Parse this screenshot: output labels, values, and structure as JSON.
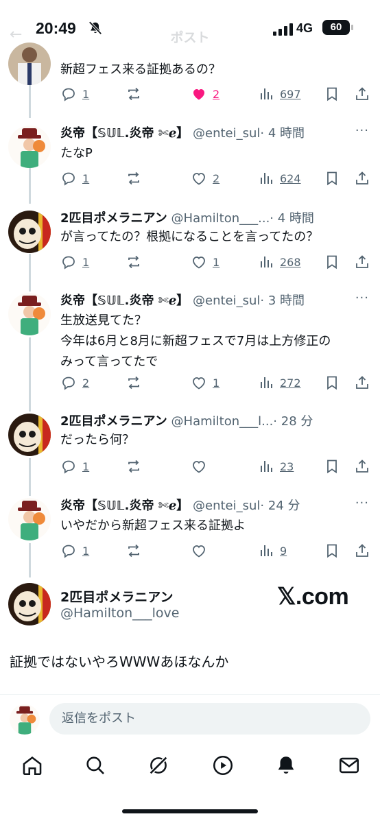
{
  "status_bar": {
    "time": "20:49",
    "network": "4G",
    "battery": "60"
  },
  "header": {
    "title": "ポスト",
    "back": "←"
  },
  "tweets": [
    {
      "name": "",
      "handle": "",
      "time": "",
      "text": "新超フェス来る証拠あるの？",
      "replies": "1",
      "reposts": "",
      "likes": "2",
      "views": "697",
      "liked": true
    },
    {
      "name": "炎帝【𝕊𝕌𝕃.炎帝 ✄ℯ】",
      "handle": "@entei_sul",
      "time": "· 4 時間",
      "text": "たなP",
      "replies": "1",
      "reposts": "",
      "likes": "2",
      "views": "624"
    },
    {
      "name": "2匹目ポメラニアン",
      "handle": "@Hamilton___...",
      "time": "· 4 時間",
      "text": "が言ってたの？根拠になることを言ってたの？",
      "replies": "1",
      "reposts": "",
      "likes": "1",
      "views": "268"
    },
    {
      "name": "炎帝【𝕊𝕌𝕃.炎帝 ✄ℯ】",
      "handle": "@entei_sul",
      "time": "· 3 時間",
      "text": "生放送見てた？\n今年は6月と8月に新超フェスで7月は上方修正の\nみって言ってたで",
      "replies": "2",
      "reposts": "",
      "likes": "1",
      "views": "272"
    },
    {
      "name": "2匹目ポメラニアン",
      "handle": "@Hamilton___l...",
      "time": "· 28 分",
      "text": "だったら何？",
      "replies": "1",
      "reposts": "",
      "likes": "",
      "views": "23"
    },
    {
      "name": "炎帝【𝕊𝕌𝕃.炎帝 ✄ℯ】",
      "handle": "@entei_sul",
      "time": "· 24 分",
      "text": "いやだから新超フェス来る証拠よ",
      "replies": "1",
      "reposts": "",
      "likes": "",
      "views": "9"
    }
  ],
  "main_post": {
    "name": "2匹目ポメラニアン",
    "handle": "@Hamilton___love",
    "watermark": "𝕏.com",
    "text": "証拠ではないやろWWWあほなんか"
  },
  "reply_bar": {
    "placeholder": "返信をポスト"
  },
  "colors": {
    "like_active": "#f91880",
    "icon_gray": "#536471",
    "thread_line": "#cfd9de"
  },
  "nav": [
    "home-icon",
    "search-icon",
    "grok-icon",
    "video-icon",
    "notifications-icon",
    "messages-icon"
  ]
}
